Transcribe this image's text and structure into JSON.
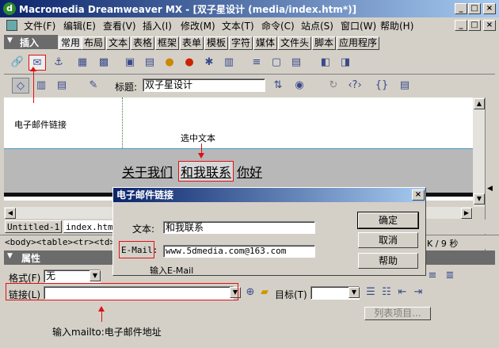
{
  "window": {
    "title": "Macromedia Dreamweaver MX - [双子星设计 (media/index.htm*)]",
    "controls": [
      "_",
      "□",
      "×"
    ]
  },
  "menu": [
    "文件(F)",
    "编辑(E)",
    "查看(V)",
    "插入(I)",
    "修改(M)",
    "文本(T)",
    "命令(C)",
    "站点(S)",
    "窗口(W)",
    "帮助(H)"
  ],
  "insert_panel": {
    "title": "插入",
    "tabs": [
      "常用",
      "布局",
      "文本",
      "表格",
      "框架",
      "表单",
      "模板",
      "字符",
      "媒体",
      "文件头",
      "脚本",
      "应用程序"
    ]
  },
  "doc_toolbar": {
    "title_label": "标题:",
    "title_value": "双子星设计"
  },
  "annotations": {
    "email_link": "电子邮件链接",
    "select_text": "选中文本",
    "enter_email": "输入E-Mail",
    "enter_mailto": "输入mailto:电子邮件地址"
  },
  "document": {
    "links": [
      "关于我们",
      "和我联系",
      "你好"
    ]
  },
  "tabs_bottom": [
    "Untitled-1",
    "index.htm"
  ],
  "tag_selector": "<body><table><tr><td>",
  "status_right": "K / 9 秒",
  "dialog": {
    "title": "电子邮件链接",
    "text_label": "文本:",
    "text_value": "和我联系",
    "email_label": "E-Mail:",
    "email_value": "www.5dmedia.com@163.com",
    "ok": "确定",
    "cancel": "取消",
    "help": "帮助"
  },
  "properties": {
    "title": "属性",
    "format_label": "格式(F)",
    "format_value": "无",
    "link_label": "链接(L)",
    "link_value": "",
    "target_label": "目标(T)",
    "list_button": "列表项目..."
  }
}
